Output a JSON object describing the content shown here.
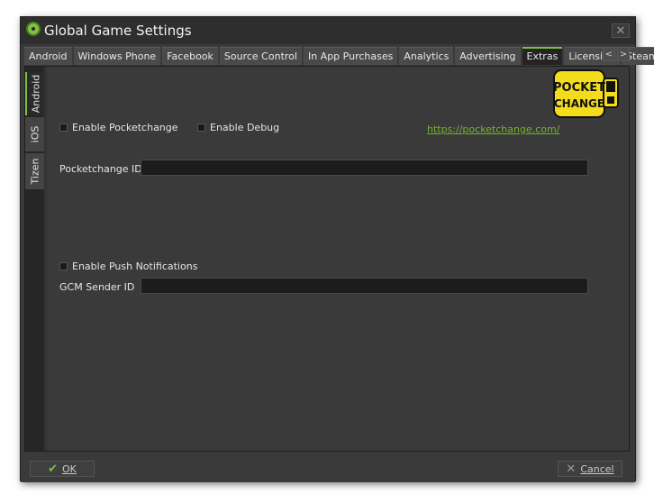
{
  "window": {
    "title": "Global Game Settings",
    "close_symbol": "✕"
  },
  "tabs": [
    {
      "label": "Android"
    },
    {
      "label": "Windows Phone"
    },
    {
      "label": "Facebook"
    },
    {
      "label": "Source Control"
    },
    {
      "label": "In App Purchases"
    },
    {
      "label": "Analytics"
    },
    {
      "label": "Advertising"
    },
    {
      "label": "Extras",
      "active": true
    },
    {
      "label": "Licensing"
    },
    {
      "label": "Steam"
    }
  ],
  "tab_scroll": {
    "left": "<",
    "right": ">"
  },
  "platform_tabs": [
    {
      "label": "Android",
      "active": true
    },
    {
      "label": "iOS"
    },
    {
      "label": "Tizen"
    }
  ],
  "pocketchange": {
    "enable_label": "Enable Pocketchange",
    "debug_label": "Enable Debug",
    "link": "https://pocketchange.com/",
    "id_label": "Pocketchange ID",
    "id_value": "",
    "logo_line1": "POCKET",
    "logo_line2": "CHANGE"
  },
  "push": {
    "enable_label": "Enable Push Notifications",
    "gcm_label": "GCM Sender ID",
    "gcm_value": ""
  },
  "footer": {
    "ok_label": "OK",
    "cancel_label": "Cancel"
  },
  "colors": {
    "accent": "#7cc242",
    "link": "#75b32c",
    "logo_yellow": "#f2dc1b"
  }
}
